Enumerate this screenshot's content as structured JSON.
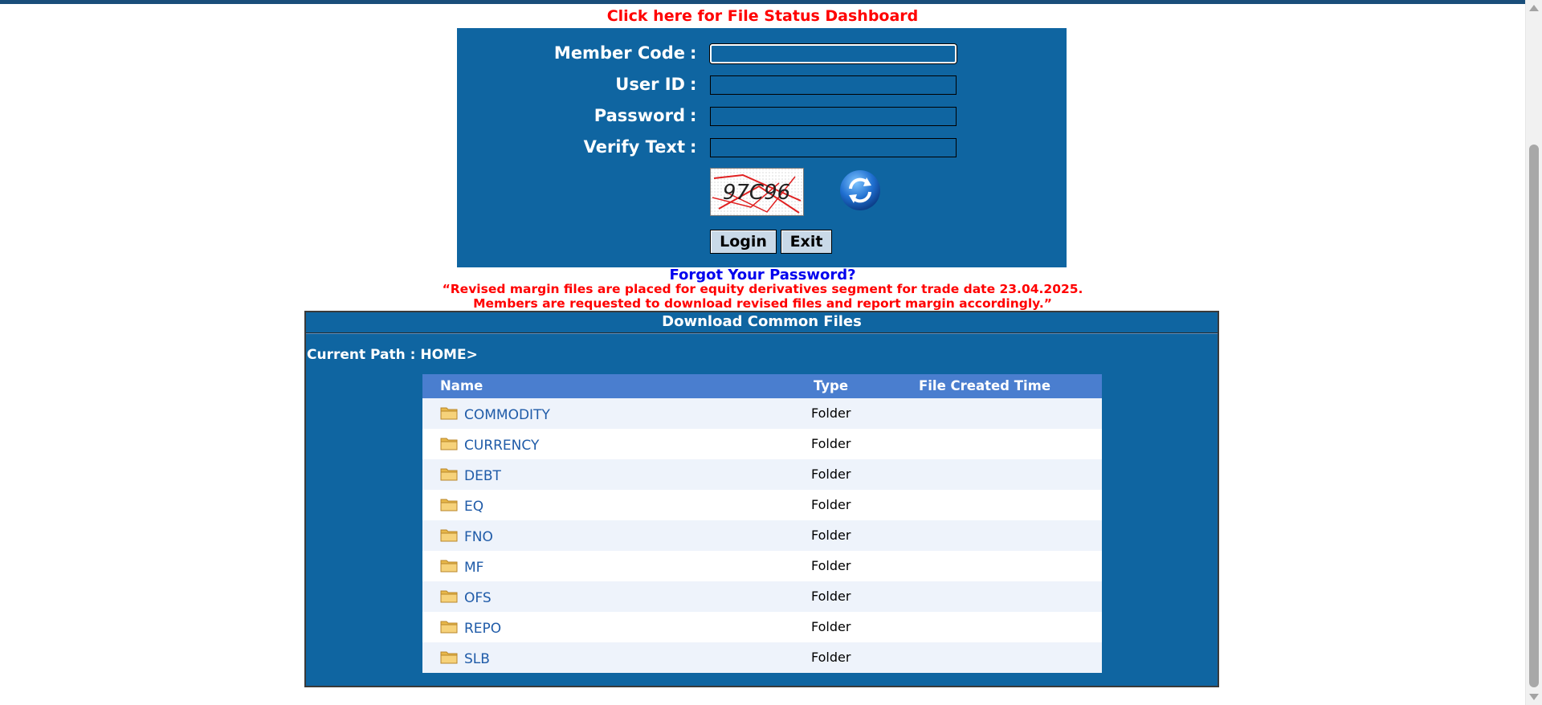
{
  "header": {
    "dashboard_link": "Click here for File Status Dashboard"
  },
  "login": {
    "fields": [
      {
        "label": "Member Code",
        "value": "",
        "focused": true
      },
      {
        "label": "User ID",
        "value": ""
      },
      {
        "label": "Password",
        "value": ""
      },
      {
        "label": "Verify Text",
        "value": ""
      }
    ],
    "colon": ":",
    "captcha_text": "97C96",
    "login_label": "Login",
    "exit_label": "Exit"
  },
  "forgot_password": "Forgot Your Password?",
  "notice": {
    "line1": "“Revised margin files are placed for equity derivatives segment for trade date 23.04.2025.",
    "line2": "Members are requested to download revised files and report margin accordingly.”"
  },
  "download": {
    "title": "Download Common Files",
    "current_path": "Current Path : HOME>",
    "columns": {
      "name": "Name",
      "type": "Type",
      "created": "File Created Time"
    },
    "rows": [
      {
        "name": "COMMODITY",
        "type": "Folder",
        "created": ""
      },
      {
        "name": "CURRENCY",
        "type": "Folder",
        "created": ""
      },
      {
        "name": "DEBT",
        "type": "Folder",
        "created": ""
      },
      {
        "name": "EQ",
        "type": "Folder",
        "created": ""
      },
      {
        "name": "FNO",
        "type": "Folder",
        "created": ""
      },
      {
        "name": "MF",
        "type": "Folder",
        "created": ""
      },
      {
        "name": "OFS",
        "type": "Folder",
        "created": ""
      },
      {
        "name": "REPO",
        "type": "Folder",
        "created": ""
      },
      {
        "name": "SLB",
        "type": "Folder",
        "created": ""
      }
    ]
  },
  "colors": {
    "panel_blue": "#0f65a1",
    "header_blue": "#4a7ecf",
    "alert_red": "#ff0000",
    "link_blue": "#0000ee",
    "folder_text": "#1f5ba8"
  }
}
